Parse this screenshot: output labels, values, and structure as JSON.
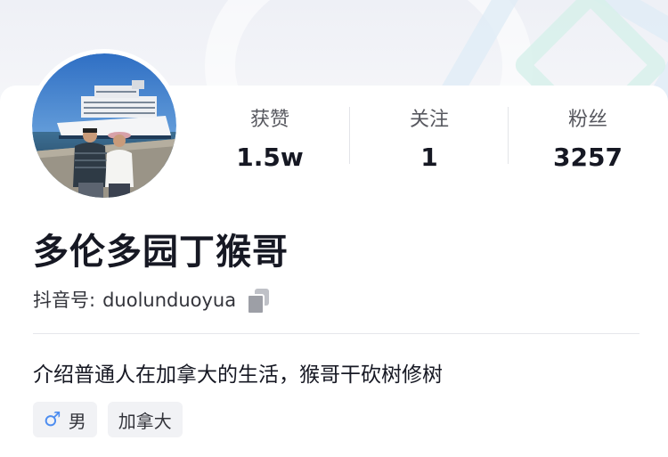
{
  "profile": {
    "name": "多伦多园丁猴哥",
    "account_label": "抖音号:",
    "account_id": "duolunduoyua",
    "bio": "介绍普通人在加拿大的生活，猴哥干砍树修树"
  },
  "stats": [
    {
      "label": "获赞",
      "value": "1.5w"
    },
    {
      "label": "关注",
      "value": "1"
    },
    {
      "label": "粉丝",
      "value": "3257"
    }
  ],
  "tags": [
    {
      "icon": "male-icon",
      "icon_glyph": "♂",
      "label": "男"
    },
    {
      "label": "加拿大"
    }
  ],
  "colors": {
    "gender_icon": "#4d8df0",
    "tag_bg": "#f1f2f5",
    "text_primary": "#161823"
  }
}
